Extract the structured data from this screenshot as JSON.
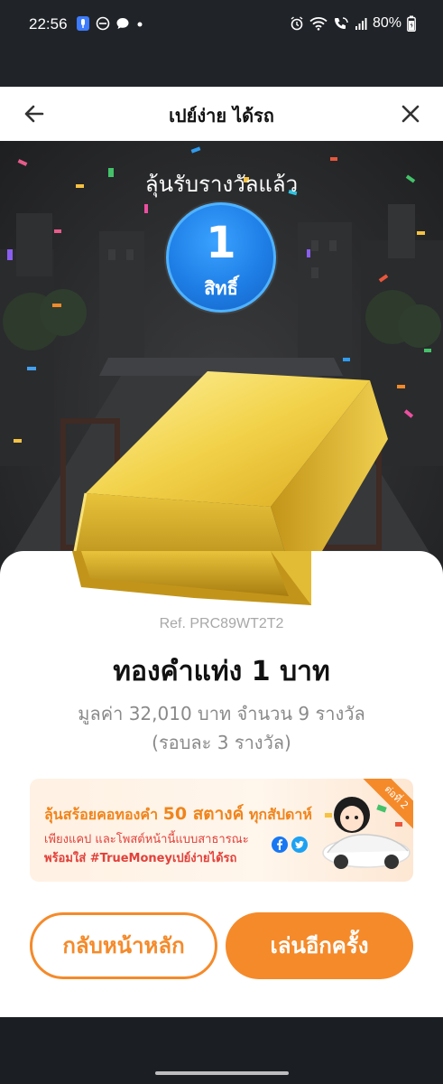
{
  "status_bar": {
    "time": "22:56",
    "battery": "80%"
  },
  "header": {
    "title": "เปย์ง่าย ได้รถ"
  },
  "scene": {
    "heading": "ลุ้นรับรางวัลแล้ว",
    "count_number": "1",
    "count_unit": "สิทธิ์"
  },
  "card": {
    "ref": "Ref. PRC89WT2T2",
    "prize_name": "ทองคำแท่ง 1 บาท",
    "prize_value": "มูลค่า 32,010 บาท จำนวน 9 รางวัล",
    "prize_round": "(รอบละ 3 รางวัล)"
  },
  "promo": {
    "line1_prefix": "ลุ้นสร้อยคอทองคำ",
    "line1_highlight": "50 สตางค์",
    "line1_suffix": "ทุกสัปดาห์",
    "line2": "เพียงแคป และโพสต์หน้านี้แบบสาธารณะ",
    "line3": "พร้อมใส่ #TrueMoneyเปย์ง่ายได้รถ",
    "ribbon": "ต่อที่ 2"
  },
  "buttons": {
    "home": "กลับหน้าหลัก",
    "play_again": "เล่นอีกครั้ง"
  },
  "colors": {
    "accent": "#f58a2a",
    "badge_blue": "#1e7ee6",
    "gold": "#e8c33a"
  }
}
